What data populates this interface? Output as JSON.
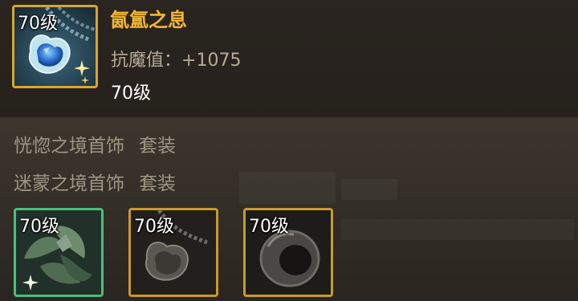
{
  "item": {
    "name": "氤氲之息",
    "level_badge": "70级",
    "stat_label": "抗魔值：",
    "stat_value": "+1075",
    "level": "70级"
  },
  "set_lines": [
    {
      "name": "恍惚之境首饰",
      "suffix": "套装"
    },
    {
      "name": "迷蒙之境首饰",
      "suffix": "套装"
    }
  ],
  "set_items": [
    {
      "level_badge": "70级",
      "icon": "leaf-bracelet-icon",
      "border_color": "#48c07a"
    },
    {
      "level_badge": "70级",
      "icon": "gem-necklace-icon",
      "border_color": "#c99a2c"
    },
    {
      "level_badge": "70级",
      "icon": "dark-ring-icon",
      "border_color": "#c99a2c"
    }
  ],
  "colors": {
    "name": "#f2b632",
    "stat": "#b7ab97",
    "set_text": "#9f9582",
    "main_border": "#d8a530"
  }
}
